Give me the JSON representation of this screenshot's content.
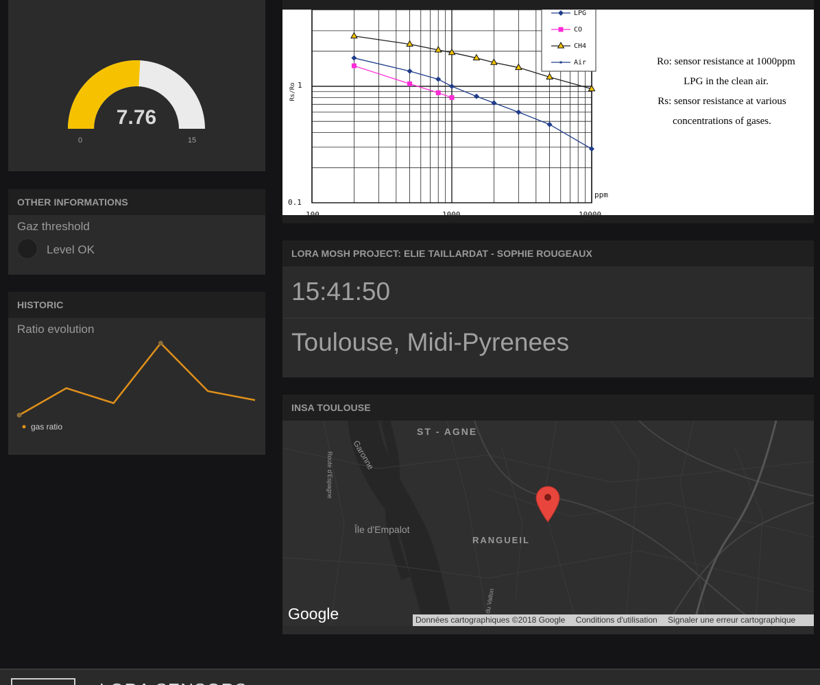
{
  "gauge": {
    "value": "7.76",
    "value_num": 7.76,
    "min": "0",
    "max": "15",
    "fill_color": "#f6c200",
    "track_color": "#ebebeb"
  },
  "other": {
    "title": "OTHER INFORMATIONS",
    "threshold_label": "Gaz threshold",
    "indicator_label": "Level OK"
  },
  "historic": {
    "title": "HISTORIC",
    "subtitle": "Ratio evolution",
    "legend": "gas ratio",
    "line_color": "#e0901a"
  },
  "datasheet": {
    "y_axis_label": "Rs/Ro",
    "y_ticks": [
      "1",
      "0.1"
    ],
    "x_ticks": [
      "100",
      "1000",
      "10000"
    ],
    "x_unit": "ppm",
    "legend": [
      "LPG",
      "CO",
      "CH4",
      "Air"
    ],
    "desc_lines": [
      "Ro: sensor resistance at 1000ppm",
      "LPG in the clean air.",
      "Rs: sensor resistance at various",
      "concentrations of gases."
    ]
  },
  "project": {
    "title": "LORA MOSH PROJECT: ELIE TAILLARDAT - SOPHIE ROUGEAUX",
    "time": "15:41:50",
    "location": "Toulouse, Midi-Pyrenees"
  },
  "map": {
    "title": "INSA TOULOUSE",
    "labels": {
      "st_agne": "ST - AGNE",
      "garonne": "Garonne",
      "route": "Route d'Espagne",
      "ile": "Île d'Empalot",
      "rangueil": "RANGUEIL",
      "vallon": "du Vallon"
    },
    "logo": "Google",
    "footer": [
      "Données cartographiques ©2018 Google",
      "Conditions d'utilisation",
      "Signaler une erreur cartographique"
    ],
    "pin_color": "#e8453c"
  },
  "bottom": {
    "title": "LORA SENSORS"
  },
  "chart_data": [
    {
      "type": "line",
      "title": "",
      "series": [
        {
          "name": "gas ratio",
          "values": [
            1.0,
            1.9,
            1.4,
            3.4,
            1.8,
            1.5
          ]
        }
      ],
      "grid": false,
      "legend": "bottom-left"
    },
    {
      "type": "line",
      "title": "",
      "xlabel": "ppm",
      "ylabel": "Rs/Ro",
      "xscale": "log",
      "yscale": "log",
      "xlim": [
        100,
        10000
      ],
      "legend": "top-right",
      "series": [
        {
          "name": "LPG",
          "x": [
            200,
            500,
            800,
            1000,
            1500,
            2000,
            3000,
            5000,
            10000
          ],
          "y": [
            1.75,
            1.35,
            1.15,
            1.0,
            0.82,
            0.72,
            0.6,
            0.47,
            0.29
          ]
        },
        {
          "name": "CO",
          "x": [
            200,
            500,
            800,
            1000
          ],
          "y": [
            1.5,
            1.05,
            0.88,
            0.8
          ]
        },
        {
          "name": "CH4",
          "x": [
            200,
            500,
            800,
            1000,
            1500,
            2000,
            3000,
            5000,
            10000
          ],
          "y": [
            2.7,
            2.3,
            2.05,
            1.95,
            1.75,
            1.6,
            1.45,
            1.2,
            0.95
          ]
        }
      ]
    }
  ]
}
